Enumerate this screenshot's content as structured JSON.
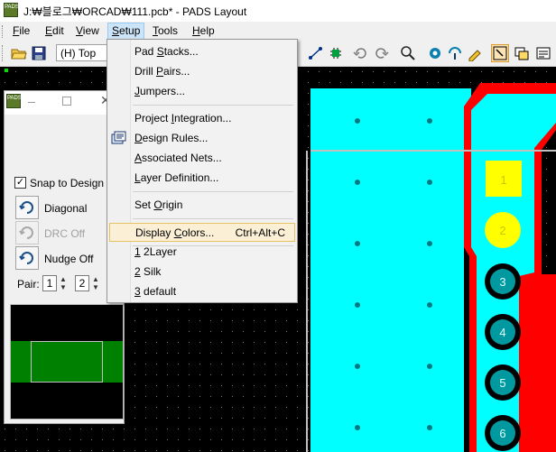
{
  "window": {
    "title": "J:₩블로그₩ORCAD₩111.pcb* - PADS Layout",
    "logo_text": "PADS"
  },
  "menubar": {
    "items": [
      {
        "pre": "",
        "key": "F",
        "post": "ile"
      },
      {
        "pre": "",
        "key": "E",
        "post": "dit"
      },
      {
        "pre": "",
        "key": "V",
        "post": "iew"
      },
      {
        "pre": "",
        "key": "S",
        "post": "etup"
      },
      {
        "pre": "",
        "key": "T",
        "post": "ools"
      },
      {
        "pre": "",
        "key": "H",
        "post": "elp"
      }
    ]
  },
  "toolbar": {
    "layer_value": "(H) Top"
  },
  "setup_menu": {
    "items": [
      {
        "pre": "Pad ",
        "key": "S",
        "post": "tacks...",
        "shortcut": ""
      },
      {
        "pre": "Drill ",
        "key": "P",
        "post": "airs...",
        "shortcut": ""
      },
      {
        "pre": "",
        "key": "J",
        "post": "umpers...",
        "shortcut": ""
      },
      {
        "pre": "Project ",
        "key": "I",
        "post": "ntegration...",
        "shortcut": ""
      },
      {
        "pre": "",
        "key": "D",
        "post": "esign Rules...",
        "shortcut": ""
      },
      {
        "pre": "",
        "key": "A",
        "post": "ssociated Nets...",
        "shortcut": ""
      },
      {
        "pre": "",
        "key": "L",
        "post": "ayer Definition...",
        "shortcut": ""
      },
      {
        "pre": "Set ",
        "key": "O",
        "post": "rigin",
        "shortcut": ""
      },
      {
        "pre": "Display ",
        "key": "C",
        "post": "olors...",
        "shortcut": "Ctrl+Alt+C"
      },
      {
        "pre": "",
        "key": "1",
        "post": " 2Layer",
        "shortcut": ""
      },
      {
        "pre": "",
        "key": "2",
        "post": " Silk",
        "shortcut": ""
      },
      {
        "pre": "",
        "key": "3",
        "post": " default",
        "shortcut": ""
      }
    ]
  },
  "panel": {
    "logo_text": "PADS",
    "snap_label": "Snap to Design Gr",
    "snap_checked": true,
    "diagonal_label": "Diagonal",
    "drc_label": "DRC Off",
    "nudge_label": "Nudge Off",
    "pair_label": "Pair:",
    "pair_value_1": "1",
    "pair_value_2": "2"
  },
  "board": {
    "pins": [
      "1",
      "2",
      "3",
      "4",
      "5",
      "6"
    ],
    "colors": {
      "copper": "#00ffff",
      "trace": "#ff0000",
      "pad_yellow": "#ffff00",
      "pad_teal": "#0099a0",
      "background": "#000000"
    }
  }
}
